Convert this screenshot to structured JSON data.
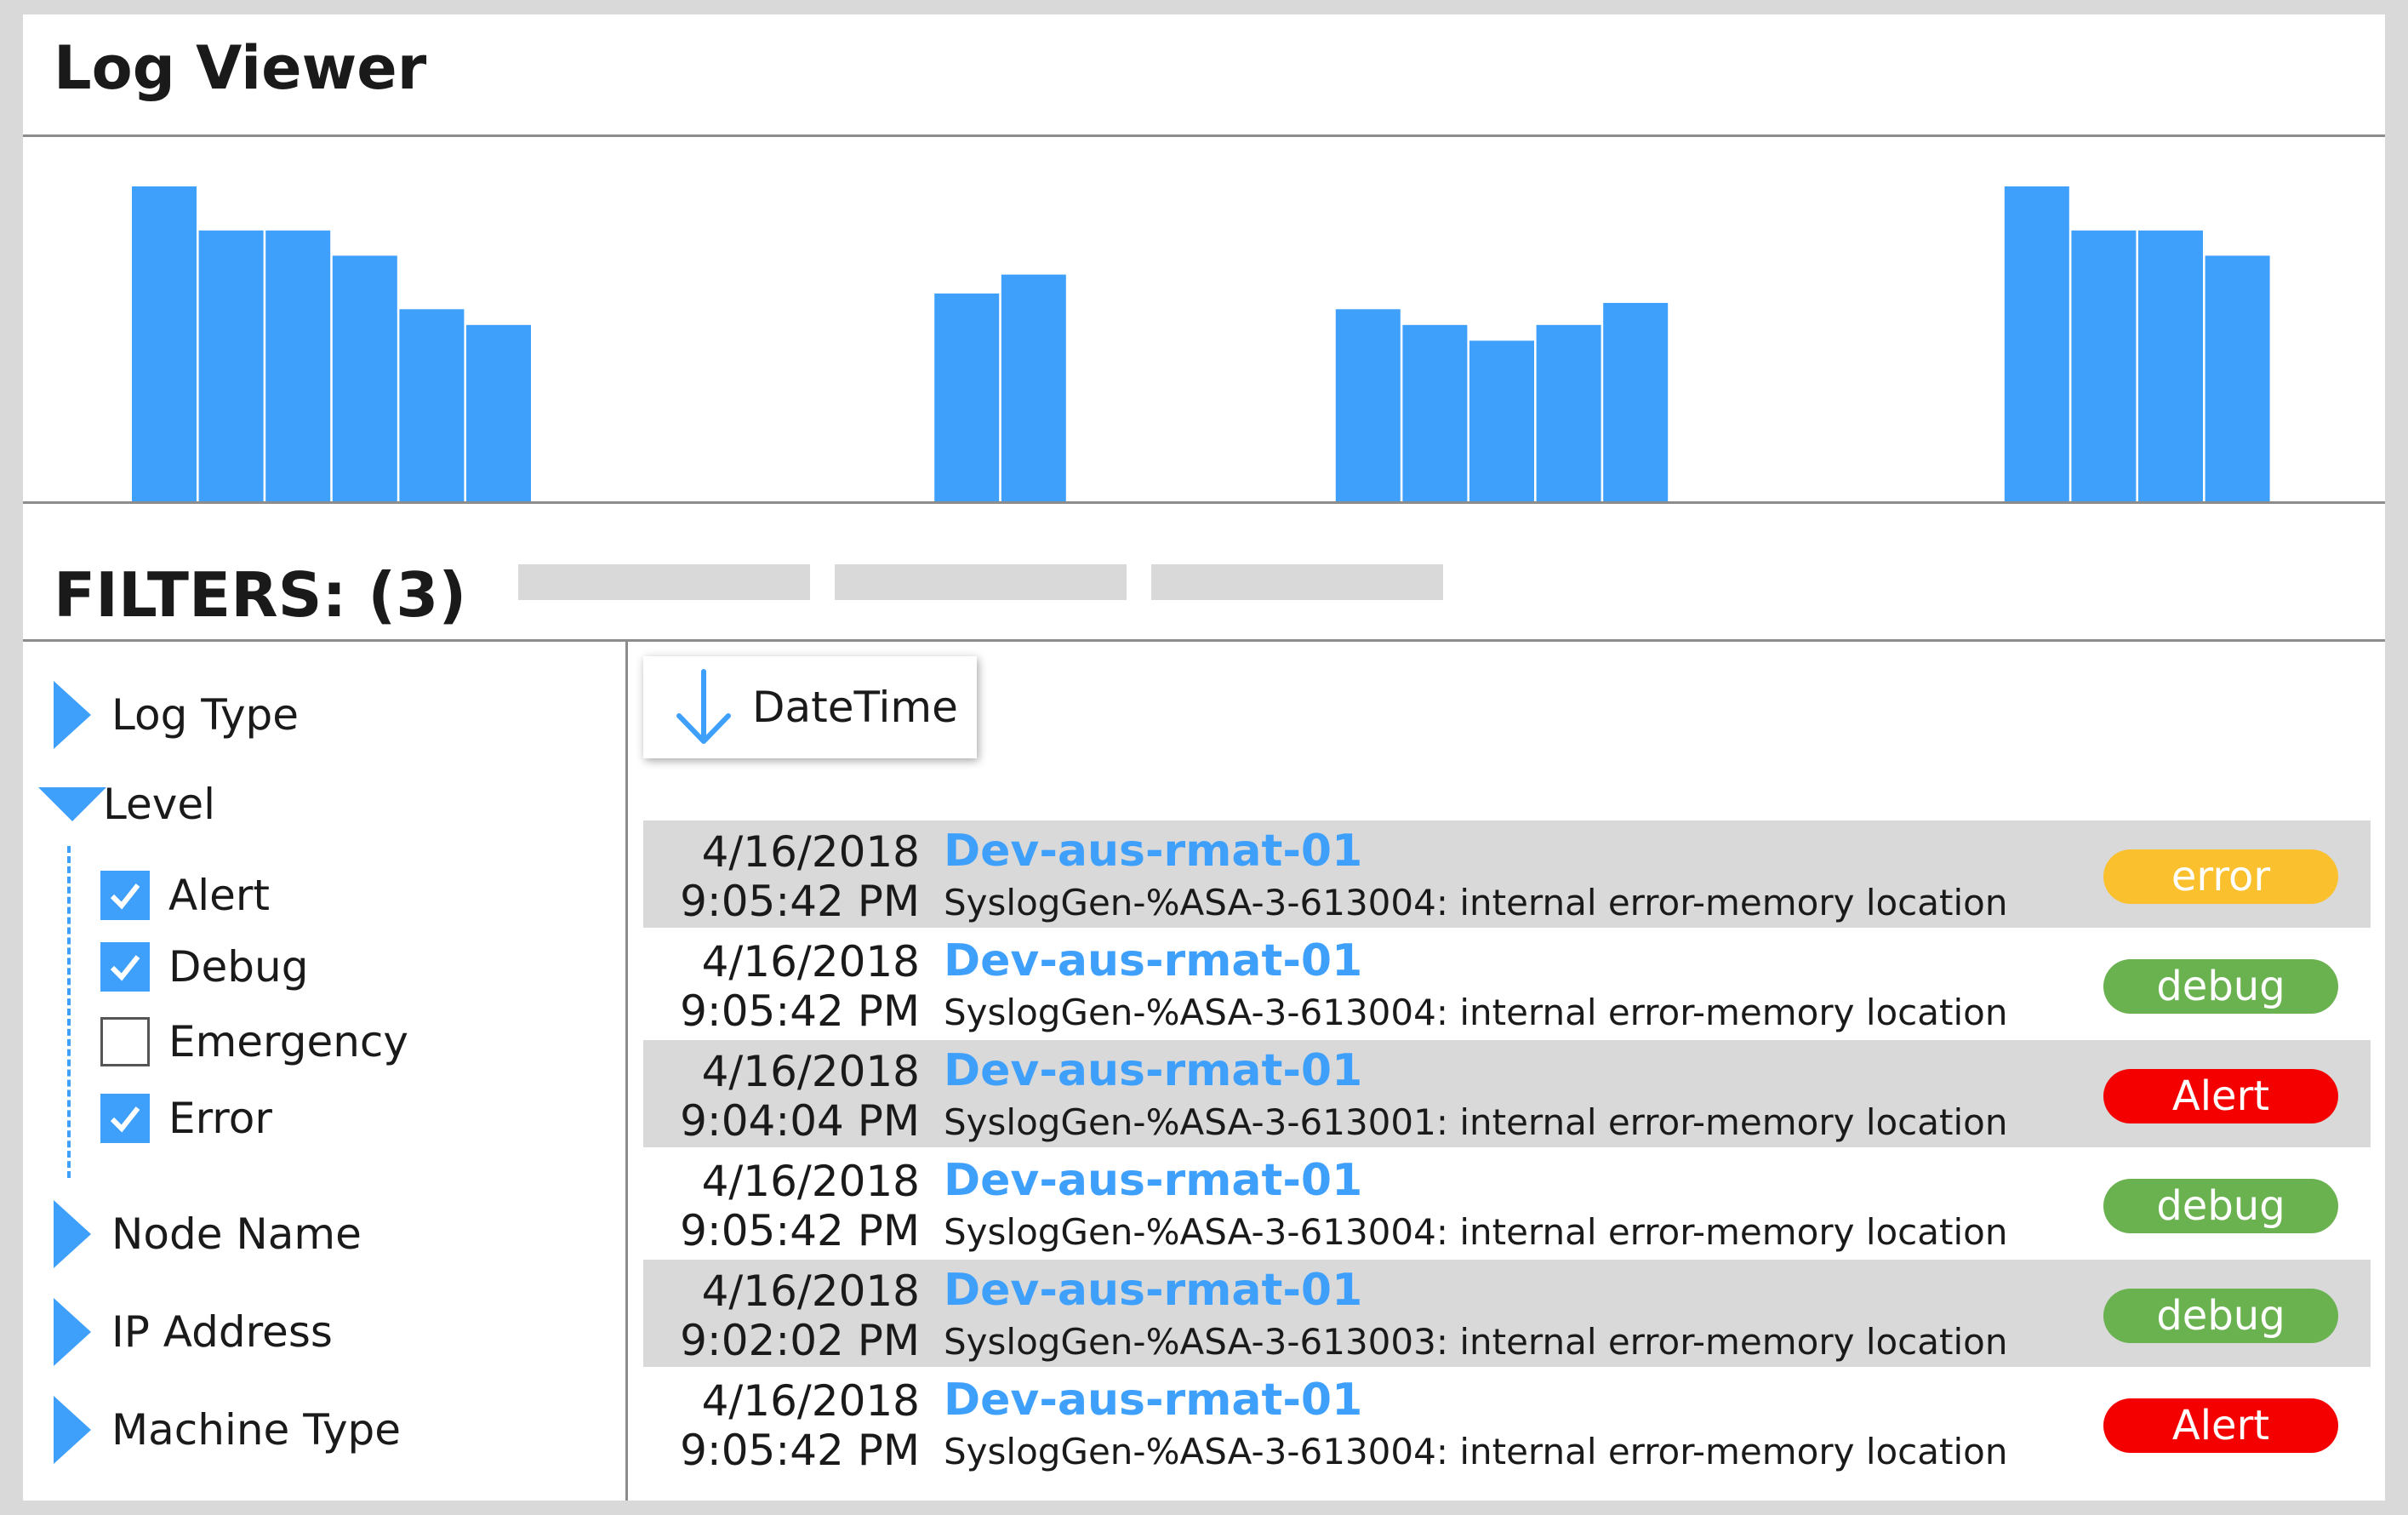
{
  "app": {
    "title": "Log Viewer"
  },
  "colors": {
    "accent": "#3fa0fb",
    "error": "#fbc02d",
    "debug": "#6ab150",
    "alert": "#f40000",
    "row_shade": "#d9d9d9"
  },
  "histogram": {
    "values": [
      10,
      8.6,
      8.6,
      7.8,
      6.1,
      5.6,
      0,
      0,
      0,
      0,
      0,
      0,
      6.6,
      7.2,
      0,
      0,
      0,
      0,
      6.1,
      5.6,
      5.1,
      5.6,
      6.3,
      0,
      0,
      0,
      0,
      0,
      10,
      8.6,
      8.6,
      7.8
    ]
  },
  "filters": {
    "header": "FILTERS: (3)",
    "groups": [
      {
        "label": "Log Type",
        "expanded": false
      },
      {
        "label": "Level",
        "expanded": true
      },
      {
        "label": "Node Name",
        "expanded": false
      },
      {
        "label": "IP Address",
        "expanded": false
      },
      {
        "label": "Machine Type",
        "expanded": false
      }
    ],
    "level_options": [
      {
        "label": "Alert",
        "checked": true
      },
      {
        "label": "Debug",
        "checked": true
      },
      {
        "label": "Emergency",
        "checked": false
      },
      {
        "label": "Error",
        "checked": true
      }
    ]
  },
  "sort": {
    "label": "DateTime",
    "icon": "arrow-down-icon"
  },
  "logs": [
    {
      "date": "4/16/2018",
      "time": "9:05:42 PM",
      "node": "Dev-aus-rmat-01",
      "message": "SyslogGen-%ASA-3-613004: internal error-memory location",
      "level": "error"
    },
    {
      "date": "4/16/2018",
      "time": "9:05:42 PM",
      "node": "Dev-aus-rmat-01",
      "message": "SyslogGen-%ASA-3-613004: internal error-memory location",
      "level": "debug"
    },
    {
      "date": "4/16/2018",
      "time": "9:04:04 PM",
      "node": "Dev-aus-rmat-01",
      "message": "SyslogGen-%ASA-3-613001: internal error-memory location",
      "level": "Alert"
    },
    {
      "date": "4/16/2018",
      "time": "9:05:42 PM",
      "node": "Dev-aus-rmat-01",
      "message": "SyslogGen-%ASA-3-613004: internal error-memory location",
      "level": "debug"
    },
    {
      "date": "4/16/2018",
      "time": "9:02:02 PM",
      "node": "Dev-aus-rmat-01",
      "message": "SyslogGen-%ASA-3-613003: internal error-memory location",
      "level": "debug"
    },
    {
      "date": "4/16/2018",
      "time": "9:05:42 PM",
      "node": "Dev-aus-rmat-01",
      "message": "SyslogGen-%ASA-3-613004: internal error-memory location",
      "level": "Alert"
    }
  ]
}
